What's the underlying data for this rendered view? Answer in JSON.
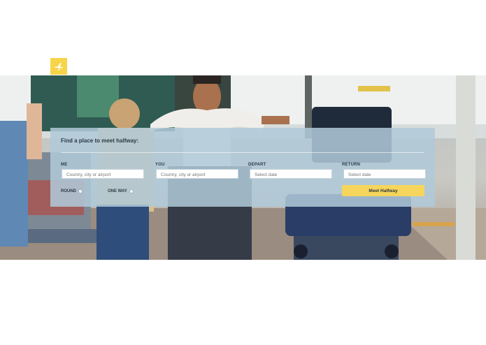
{
  "brand": {
    "logo_icon": "plane-icon",
    "accent": "#f5d55b"
  },
  "search": {
    "title": "Find a place to meet halfway:",
    "me": {
      "label": "ME",
      "placeholder": "Country, city or airport"
    },
    "you": {
      "label": "YOU",
      "placeholder": "Country, city or airport"
    },
    "depart": {
      "label": "DEPART",
      "placeholder": "Select date"
    },
    "return": {
      "label": "RETURN",
      "placeholder": "Select date"
    },
    "trip_types": [
      {
        "label": "ROUND"
      },
      {
        "label": "ONE WAY"
      }
    ],
    "submit_label": "Meet Halfway"
  }
}
